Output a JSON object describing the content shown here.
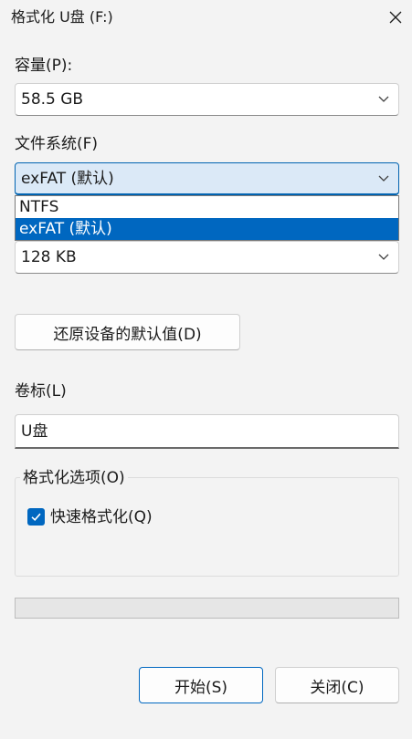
{
  "window": {
    "title": "格式化 U盘 (F:)"
  },
  "capacity": {
    "label": "容量(P):",
    "value": "58.5 GB"
  },
  "filesystem": {
    "label": "文件系统(F)",
    "value": "exFAT (默认)",
    "options": [
      "NTFS",
      "exFAT (默认)"
    ],
    "selected_index": 1
  },
  "allocation": {
    "value": "128 KB"
  },
  "restore_button": {
    "label": "还原设备的默认值(D)"
  },
  "volume": {
    "label": "卷标(L)",
    "value": "U盘"
  },
  "format_options": {
    "label": "格式化选项(O)",
    "quick_format_label": "快速格式化(Q)",
    "quick_format_checked": true
  },
  "progress": {
    "fraction": 0
  },
  "buttons": {
    "start": "开始(S)",
    "close": "关闭(C)"
  },
  "colors": {
    "accent": "#0067c0",
    "background": "#f3f3f3"
  },
  "icons": {
    "close": "close-icon",
    "dropdown": "chevron-down-icon",
    "check": "checkmark-icon"
  }
}
